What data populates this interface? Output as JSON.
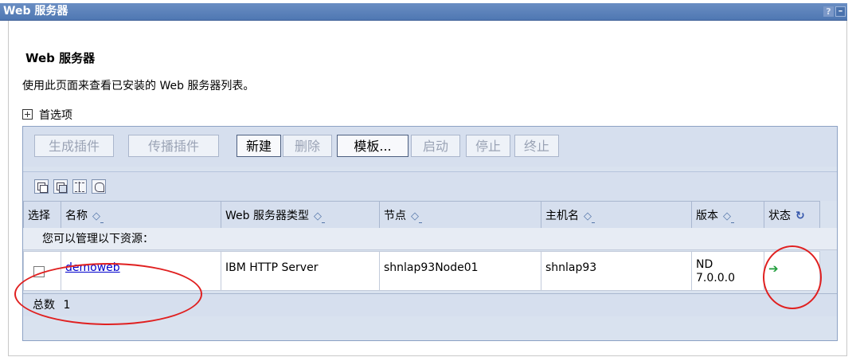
{
  "window": {
    "title": "Web 服务器",
    "help_label": "?",
    "minimize_label": "–"
  },
  "page": {
    "heading": "Web 服务器",
    "description": "使用此页面来查看已安装的 Web 服务器列表。",
    "preferences_label": "首选项"
  },
  "toolbar": {
    "buttons": [
      {
        "label": "生成插件",
        "enabled": false
      },
      {
        "label": "传播插件",
        "enabled": false
      },
      {
        "label": "新建",
        "enabled": true
      },
      {
        "label": "删除",
        "enabled": false
      },
      {
        "label": "模板...",
        "enabled": true
      },
      {
        "label": "启动",
        "enabled": false
      },
      {
        "label": "停止",
        "enabled": false
      },
      {
        "label": "终止",
        "enabled": false
      }
    ],
    "icons": [
      "select-all-icon",
      "deselect-all-icon",
      "show-filter-icon",
      "clear-filter-icon"
    ]
  },
  "table": {
    "columns": [
      {
        "label": "选择",
        "sortable": false
      },
      {
        "label": "名称",
        "sortable": true
      },
      {
        "label": "Web 服务器类型",
        "sortable": true
      },
      {
        "label": "节点",
        "sortable": true
      },
      {
        "label": "主机名",
        "sortable": true
      },
      {
        "label": "版本",
        "sortable": true
      },
      {
        "label": "状态",
        "sortable": false
      }
    ],
    "sort_glyph": "◇",
    "section_label": "您可以管理以下资源：",
    "rows": [
      {
        "name": "demoweb",
        "type": "IBM HTTP Server",
        "node": "shnlap93Node01",
        "host": "shnlap93",
        "version": "ND 7.0.0.0",
        "status_icon": "started-arrow-icon",
        "checked": false
      }
    ],
    "total_label": "总数",
    "total_value": "1"
  },
  "colors": {
    "titlebar": "#5a80b9",
    "panel": "#d6dfee",
    "link": "#0000cc",
    "status_ok": "#1f9d3a",
    "annotation": "#e02020"
  }
}
